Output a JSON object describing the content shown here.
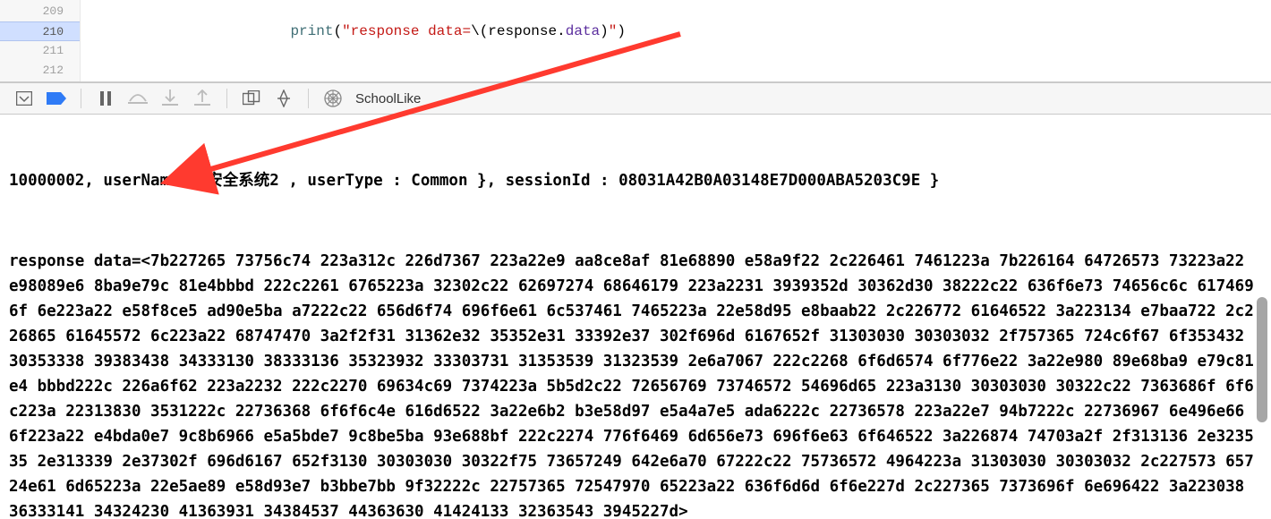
{
  "editor": {
    "gutter": [
      "209",
      "210",
      "211",
      "212"
    ],
    "highlighted_index": 1,
    "code_indent": "                        ",
    "code_fn": "print",
    "code_open": "(",
    "code_str1": "\"response data=",
    "code_esc": "\\(",
    "code_var": "response",
    "code_dot": ".",
    "code_prop": "data",
    "code_closeesc": ")",
    "code_str2": "\"",
    "code_close": ")"
  },
  "toolbar": {
    "scheme": "SchoolLike"
  },
  "console": {
    "truncated": "10000002, userName : 安全系统2 , userType : Common }, sessionId : 08031A42B0A03148E7D000ABA5203C9E }",
    "prefix": "response data=<",
    "hex": "7b227265 73756c74 223a312c 226d7367 223a22e9 aa8ce8af 81e68890 e58a9f22 2c226461 7461223a 7b226164 64726573 73223a22 e98089e6 8ba9e79c 81e4bbbd 222c2261 6765223a 32302c22 62697274 68646179 223a2231 3939352d 30362d30 38222c22 636f6e73 74656c6c 6174696f 6e223a22 e58f8ce5 ad90e5ba a7222c22 656d6f74 696f6e61 6c537461 7465223a 22e58d95 e8baab22 2c226772 61646522 3a223134 e7baa722 2c226865 61645572 6c223a22 68747470 3a2f2f31 31362e32 35352e31 33392e37 302f696d 6167652f 31303030 30303032 2f757365 724c6f67 6f353432 30353338 39383438 34333130 38333136 35323932 33303731 31353539 31323539 2e6a7067 222c2268 6f6d6574 6f776e22 3a22e980 89e68ba9 e79c81e4 bbbd222c 226a6f62 223a2232 222c2270 69634c69 7374223a 5b5d2c22 72656769 73746572 54696d65 223a3130 30303030 30322c22 7363686f 6f6c223a 22313830 3531222c 22736368 6f6f6c4e 616d6522 3a22e6b2 b3e58d97 e5a4a7e5 ada6222c 22736578 223a22e7 94b7222c 22736967 6e496e66 6f223a22 e4bda0e7 9c8b6966 e5a5bde7 9c8be5ba 93e688bf 222c2274 776f6469 6d656e73 696f6e63 6f646522 3a226874 74703a2f 2f313136 2e323535 2e313339 2e37302f 696d6167 652f3130 30303030 30322f75 73657249 642e6a70 67222c22 75736572 4964223a 31303030 30303032 2c227573 65724e61 6d65223a 22e5ae89 e58d93e7 b3bbe7bb 9f32222c 22757365 72547970 65223a22 636f6d6d 6f6e227d 2c227365 7373696f 6e696422 3a223038 36333141 34324230 41363931 34384537 44363630 41424133 32363543 3945227d",
    "suffix": ">"
  }
}
